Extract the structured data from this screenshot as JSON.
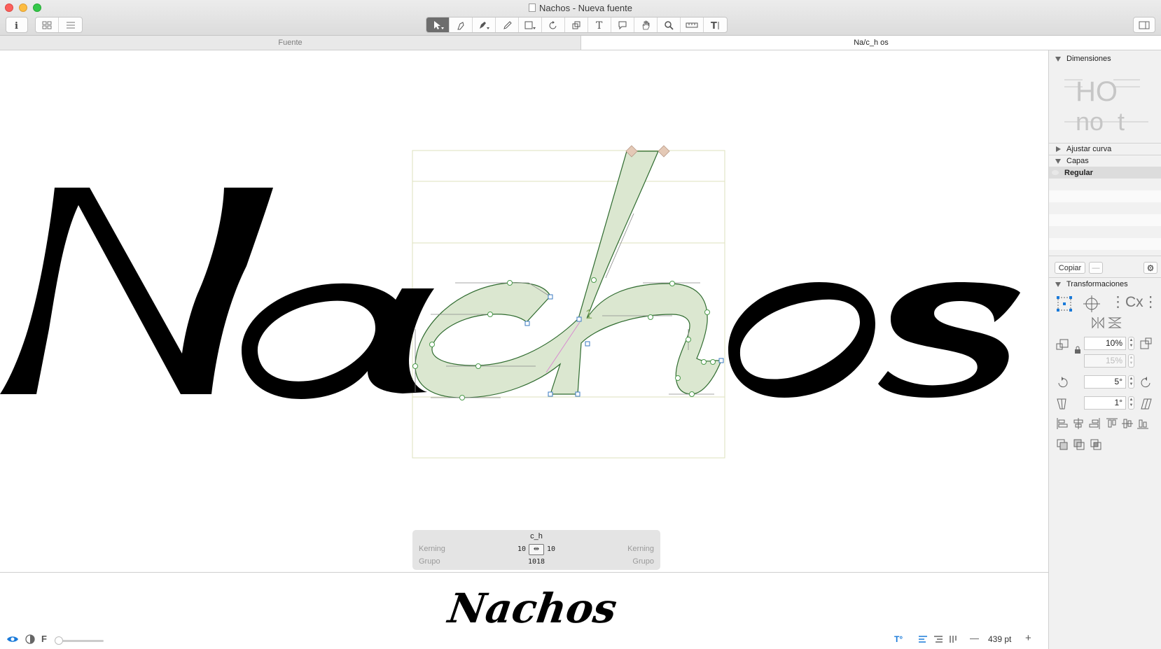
{
  "window": {
    "title": "Nachos - Nueva fuente"
  },
  "toolbar": {
    "info_icon": "info-icon",
    "view_modes": [
      "grid-view-icon",
      "list-view-icon"
    ],
    "tools": [
      "select-tool-icon",
      "draw-tool-icon",
      "pen-tool-icon",
      "pencil-tool-icon",
      "primitives-tool-icon",
      "rotate-tool-icon",
      "scale-tool-icon",
      "text-tool-icon",
      "annotation-tool-icon",
      "hand-tool-icon",
      "zoom-tool-icon",
      "measure-tool-icon",
      "type-tool-icon"
    ],
    "active_tool": "select-tool-icon"
  },
  "tabs": [
    {
      "label": "Fuente",
      "active": false
    },
    {
      "label": "Na/c_h os",
      "active": true
    }
  ],
  "canvas": {
    "text": "Nachos",
    "selected_glyph_fill": "#d9e6cc",
    "node_color": "#4a9a4a"
  },
  "kerning_panel": {
    "glyph_name": "c_h",
    "kerning_label_left": "Kerning",
    "kerning_label_right": "Kerning",
    "kerning_value_left": "10",
    "kerning_value_right": "10",
    "group_label_left": "Grupo",
    "group_label_right": "Grupo",
    "group_value": "1018"
  },
  "preview": {
    "text": "Nachos"
  },
  "bottombar": {
    "font_letter": "F",
    "size": "439 pt",
    "minus": "—",
    "plus": "+"
  },
  "sidebar": {
    "dimensiones": "Dimensiones",
    "dim_line1": "HO",
    "dim_line2": "no  t",
    "ajustar_curva": "Ajustar curva",
    "capas": "Capas",
    "layer_regular": "Regular",
    "copy_button": "Copiar",
    "remove_button": "—",
    "transformaciones": "Transformaciones",
    "scale_x": "10%",
    "scale_y": "15%",
    "rotate": "5°",
    "slant": "1°"
  }
}
